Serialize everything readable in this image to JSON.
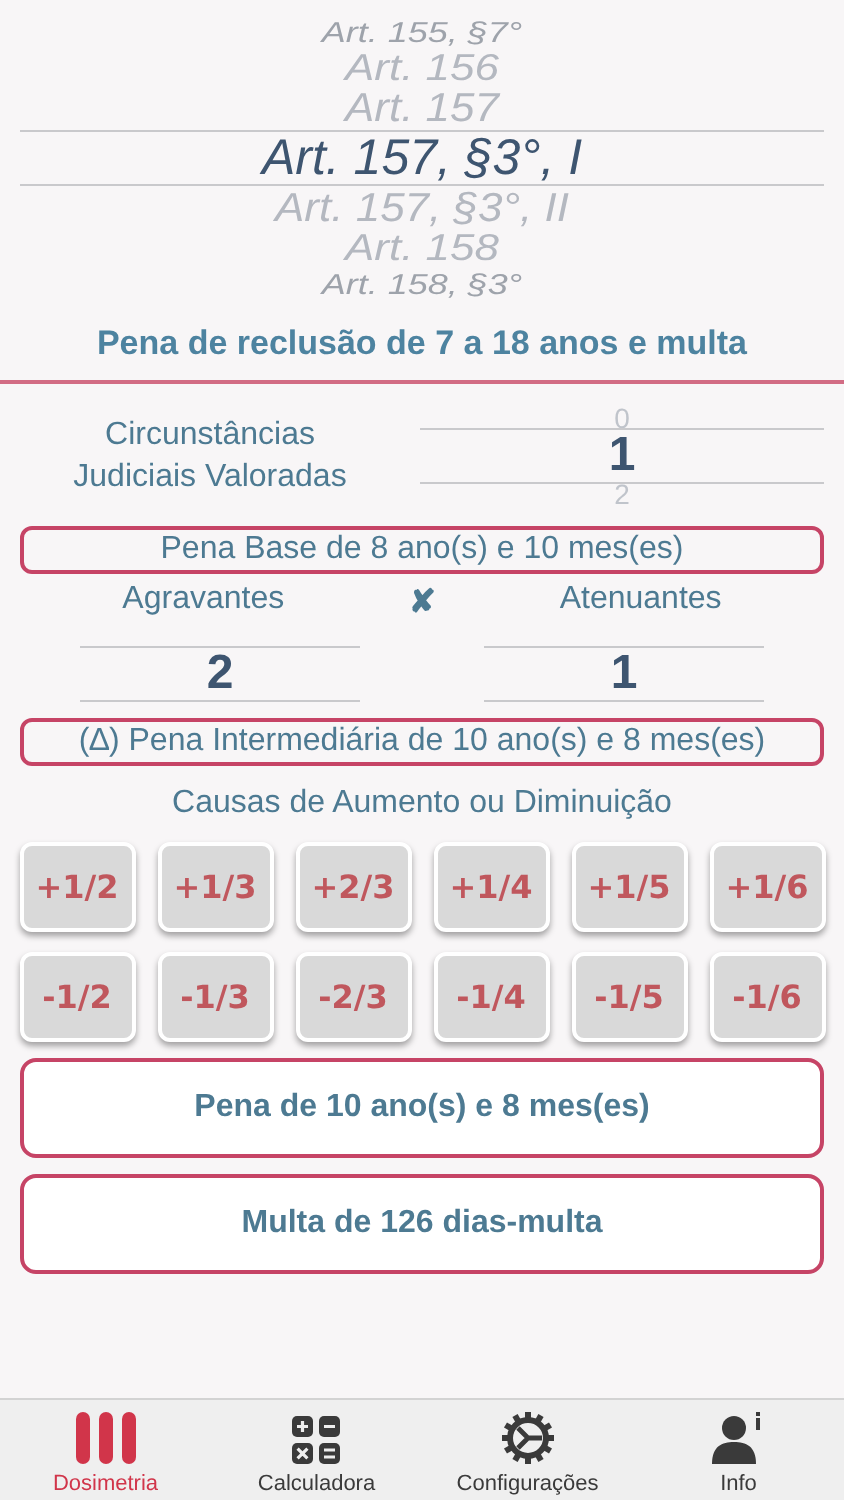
{
  "article_picker": {
    "items": [
      {
        "label": "Art. 155, §7°",
        "selected": false
      },
      {
        "label": "Art. 156",
        "selected": false
      },
      {
        "label": "Art. 157",
        "selected": false
      },
      {
        "label": "Art. 157, §3°, I",
        "selected": true
      },
      {
        "label": "Art. 157, §3°, II",
        "selected": false
      },
      {
        "label": "Art. 158",
        "selected": false
      },
      {
        "label": "Art. 158, §3°",
        "selected": false
      }
    ]
  },
  "penalty_title": "Pena de reclusão de 7 a 18 anos e multa",
  "circumstances": {
    "label": "Circunstâncias Judiciais Valoradas",
    "items": [
      {
        "label": "0",
        "selected": false
      },
      {
        "label": "1",
        "selected": true
      },
      {
        "label": "2",
        "selected": false
      }
    ]
  },
  "base_penalty": "Pena Base de 8 ano(s) e 10 mes(es)",
  "aggravating": {
    "label": "Agravantes",
    "value": "2"
  },
  "versus": "✘",
  "mitigating": {
    "label": "Atenuantes",
    "value": "1"
  },
  "intermediate_penalty": "(∆) Pena Intermediária de  10 ano(s) e 8 mes(es)",
  "causes_title": "Causas de Aumento ou Diminuição",
  "increase_buttons": [
    "+1/2",
    "+1/3",
    "+2/3",
    "+1/4",
    "+1/5",
    "+1/6"
  ],
  "decrease_buttons": [
    "-1/2",
    "-1/3",
    "-2/3",
    "-1/4",
    "-1/5",
    "-1/6"
  ],
  "final_penalty": "Pena de 10 ano(s) e 8 mes(es)",
  "fine": "Multa de 126 dias-multa",
  "tab_bar": [
    {
      "label": "Dosimetria",
      "kind": "bars",
      "selected": true
    },
    {
      "label": "Calculadora",
      "kind": "calculator",
      "selected": false
    },
    {
      "label": "Configurações",
      "kind": "gear",
      "selected": false
    },
    {
      "label": "Info",
      "kind": "person",
      "selected": false
    }
  ]
}
